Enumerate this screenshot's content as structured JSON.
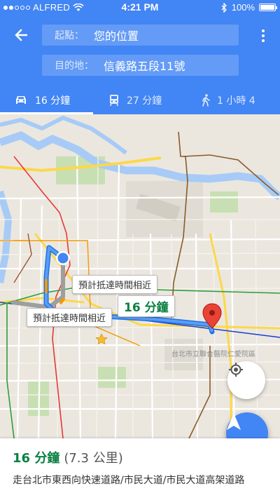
{
  "status_bar": {
    "carrier": "ALFRED",
    "time": "4:21 PM",
    "battery": "100%",
    "signal_bars": 2,
    "signal_total": 5
  },
  "search": {
    "from_label": "起點：",
    "from_value": "您的位置",
    "to_label": "目的地：",
    "to_value": "信義路五段11號"
  },
  "tabs": [
    {
      "mode": "car-icon",
      "label": "16 分鐘",
      "active": true
    },
    {
      "mode": "transit-icon",
      "label": "27 分鐘",
      "active": false
    },
    {
      "mode": "walk-icon",
      "label": "1 小時 4",
      "active": false
    }
  ],
  "map": {
    "eta_labels": [
      "預計抵達時間相近",
      "預計抵達時間相近"
    ],
    "duration_label": "16 分鐘",
    "poi_label": "台北市立聯合醫院仁愛院區"
  },
  "summary": {
    "duration": "16 分鐘",
    "distance": "(7.3 公里)",
    "route": "走台北市東西向快速道路/市民大道/市民大道高架道路"
  },
  "colors": {
    "primary": "#4285f4",
    "duration_green": "#0b8043",
    "route_blue": "#4285f4",
    "alt_route_gray": "#9e9e9e",
    "destination_pin": "#ea4335"
  }
}
